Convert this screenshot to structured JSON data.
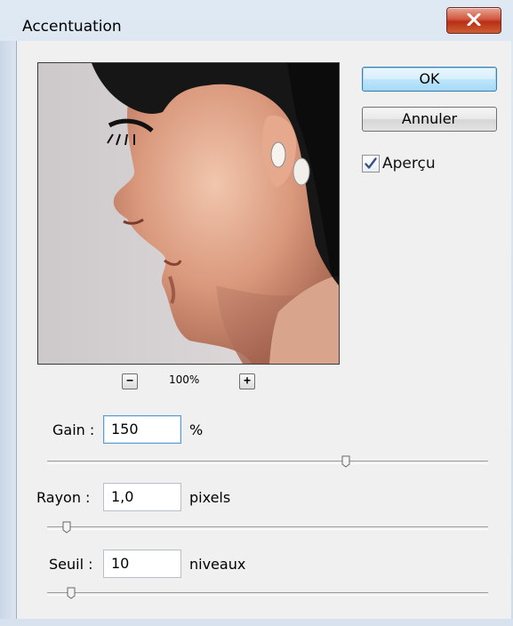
{
  "window": {
    "title": "Accentuation"
  },
  "preview": {
    "zoom_level": "100%",
    "zoom_out_label": "−",
    "zoom_in_label": "+"
  },
  "buttons": {
    "ok": "OK",
    "cancel": "Annuler"
  },
  "preview_toggle": {
    "label": "Aperçu",
    "checked": true
  },
  "params": {
    "gain": {
      "label": "Gain :",
      "value": "150",
      "unit": "%",
      "slider_fraction": 0.68
    },
    "rayon": {
      "label": "Rayon :",
      "value": "1,0",
      "unit": "pixels",
      "slider_fraction": 0.045
    },
    "seuil": {
      "label": "Seuil :",
      "value": "10",
      "unit": "niveaux",
      "slider_fraction": 0.055
    }
  },
  "colors": {
    "close_button": "#c8452b",
    "ok_button": "#bee6fd",
    "dialog_bg": "#f0f0f0"
  }
}
